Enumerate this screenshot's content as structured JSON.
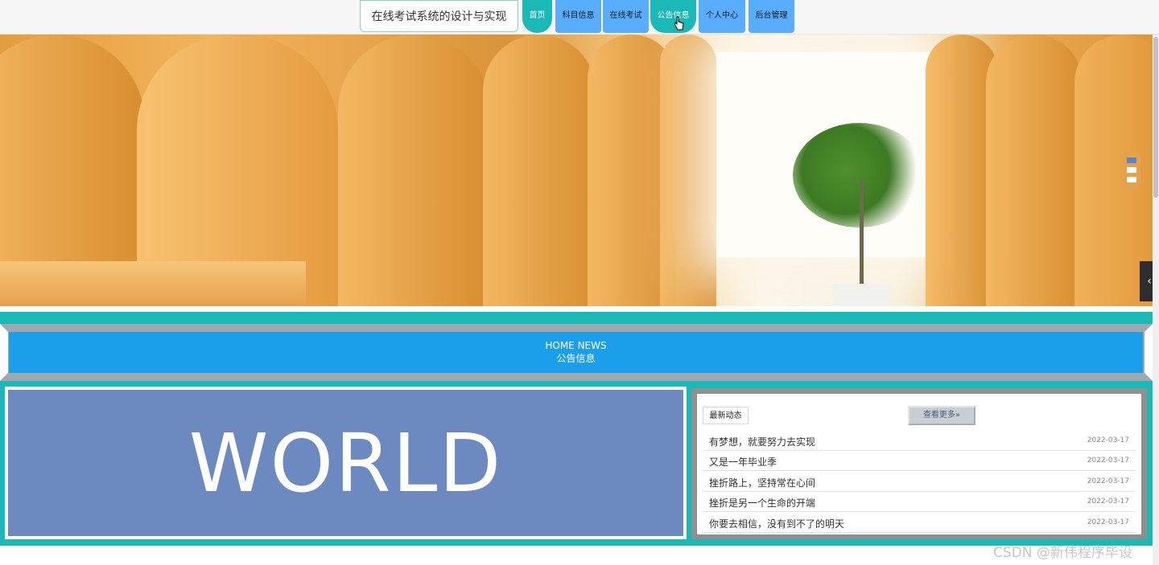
{
  "site": {
    "title": "在线考试系统的设计与实现"
  },
  "nav": {
    "items": [
      {
        "label": "首页"
      },
      {
        "label": "科目信息"
      },
      {
        "label": "在线考试"
      },
      {
        "label": "公告信息"
      },
      {
        "label": "个人中心"
      },
      {
        "label": "后台管理"
      }
    ]
  },
  "news": {
    "heading_en": "HOME NEWS",
    "heading_cn": "公告信息",
    "tab_label": "最新动态",
    "more_label": "查看更多»",
    "image_text": [
      "WORLD"
    ],
    "items": [
      {
        "title": "有梦想，就要努力去实现",
        "date": "2022-03-17"
      },
      {
        "title": "又是一年毕业季",
        "date": "2022-03-17"
      },
      {
        "title": "挫折路上，坚持常在心间",
        "date": "2022-03-17"
      },
      {
        "title": "挫折是另一个生命的开端",
        "date": "2022-03-17"
      },
      {
        "title": "你要去相信，没有到不了的明天",
        "date": "2022-03-17"
      }
    ]
  },
  "watermark": "CSDN @新伟程序毕设",
  "colors": {
    "teal": "#1ab8b6",
    "nav_blue": "#59adff",
    "banner_blue": "#1c9fea",
    "frame_gray": "#9fa8b0"
  }
}
